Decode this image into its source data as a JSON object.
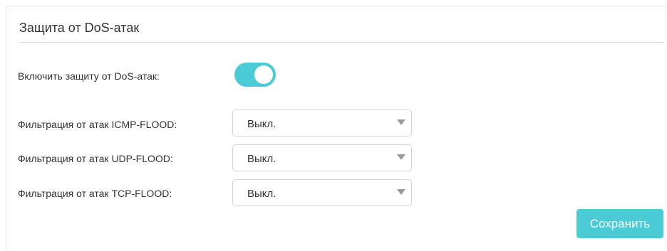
{
  "section": {
    "title": "Защита от DoS-атак"
  },
  "dos_protection": {
    "label": "Включить защиту от DoS-атак:",
    "enabled": true,
    "toggle_color": "#4acbd6"
  },
  "filters": [
    {
      "label": "Фильтрация от атак ICMP-FLOOD:",
      "value": "Выкл."
    },
    {
      "label": "Фильтрация от атак UDP-FLOOD:",
      "value": "Выкл."
    },
    {
      "label": "Фильтрация от атак TCP-FLOOD:",
      "value": "Выкл."
    }
  ],
  "actions": {
    "save_label": "Сохранить",
    "accent_color": "#4acbd6"
  }
}
